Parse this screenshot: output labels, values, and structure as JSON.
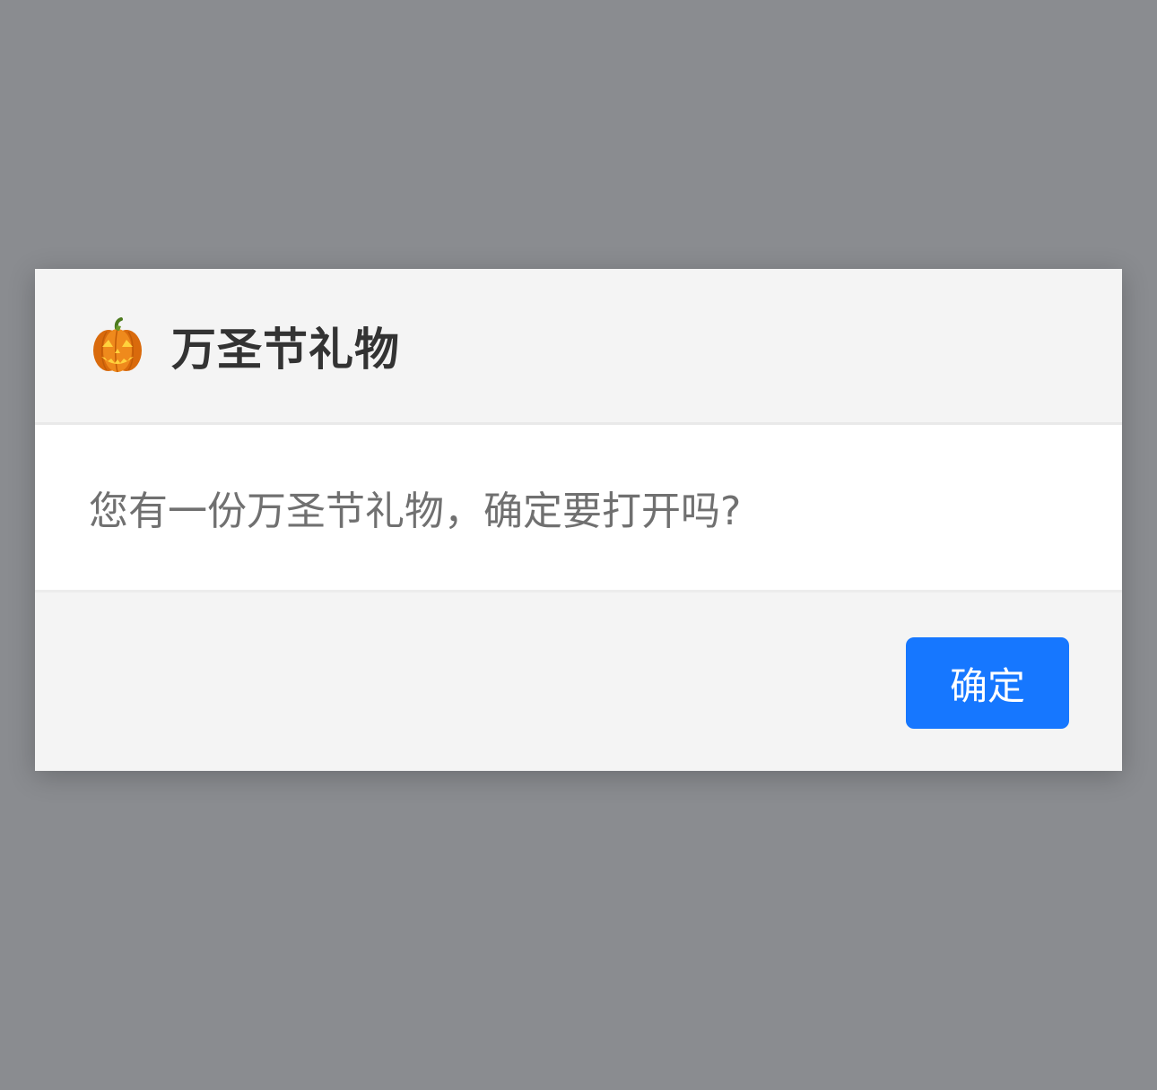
{
  "dialog": {
    "icon": "jack-o-lantern-icon",
    "title": "万圣节礼物",
    "message": "您有一份万圣节礼物，确定要打开吗?",
    "confirm_label": "确定"
  },
  "colors": {
    "overlay": "#8a8c90",
    "dialog_bg": "#f4f4f4",
    "body_bg": "#ffffff",
    "title_text": "#333333",
    "message_text": "#707070",
    "primary_button": "#1677ff",
    "pumpkin": "#e87a12"
  }
}
